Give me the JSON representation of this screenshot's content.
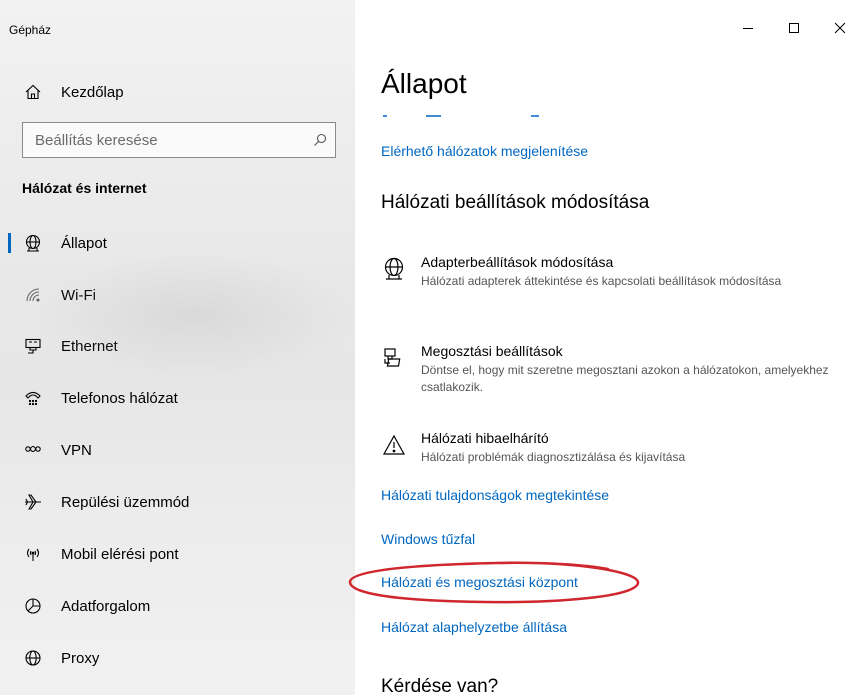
{
  "app": {
    "title": "Gépház"
  },
  "window_controls": {
    "minimize": "—",
    "maximize": "☐",
    "close": "✕"
  },
  "sidebar": {
    "home_label": "Kezdőlap",
    "search_placeholder": "Beállítás keresése",
    "section_title": "Hálózat és internet",
    "items": [
      {
        "label": "Állapot",
        "icon": "status-globe-icon",
        "active": true
      },
      {
        "label": "Wi-Fi",
        "icon": "wifi-icon"
      },
      {
        "label": "Ethernet",
        "icon": "ethernet-icon"
      },
      {
        "label": "Telefonos hálózat",
        "icon": "dialup-icon"
      },
      {
        "label": "VPN",
        "icon": "vpn-icon"
      },
      {
        "label": "Repülési üzemmód",
        "icon": "airplane-icon"
      },
      {
        "label": "Mobil elérési pont",
        "icon": "hotspot-icon"
      },
      {
        "label": "Adatforgalom",
        "icon": "data-usage-icon"
      },
      {
        "label": "Proxy",
        "icon": "proxy-globe-icon"
      }
    ]
  },
  "main": {
    "page_title": "Állapot",
    "show_networks_link": "Elérhető hálózatok megjelenítése",
    "section_change_title": "Hálózati beállítások módosítása",
    "settings": [
      {
        "title": "Adapterbeállítások módosítása",
        "desc": "Hálózati adapterek áttekintése és kapcsolati beállítások módosítása",
        "icon": "adapter-globe-icon"
      },
      {
        "title": "Megosztási beállítások",
        "desc": "Döntse el, hogy mit szeretne megosztani azokon a hálózatokon, amelyekhez csatlakozik.",
        "icon": "sharing-icon"
      },
      {
        "title": "Hálózati hibaelhárító",
        "desc": "Hálózati problémák diagnosztizálása és kijavítása",
        "icon": "warning-icon"
      }
    ],
    "links": [
      "Hálózati tulajdonságok megtekintése",
      "Windows tűzfal",
      "Hálózati és megosztási központ",
      "Hálózat alaphelyzetbe állítása"
    ],
    "question_title": "Kérdése van?"
  },
  "colors": {
    "accent": "#0067c0",
    "annotation": "#d0262d"
  }
}
